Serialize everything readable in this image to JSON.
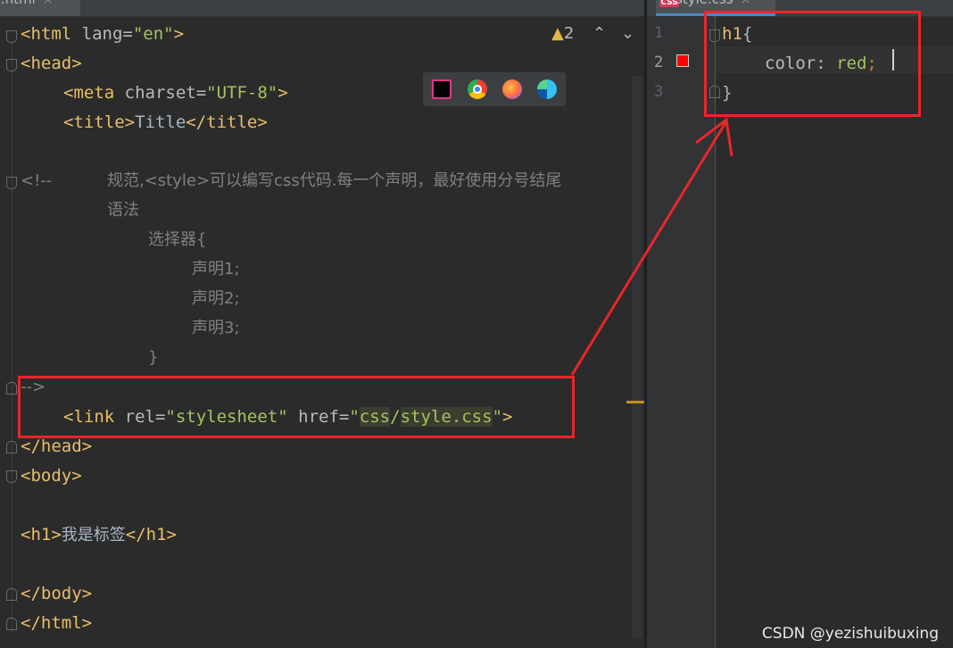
{
  "tabs": {
    "left_label": "x.html",
    "right_label": "style.css",
    "right_badge": "CSS",
    "close_glyph": "×"
  },
  "toolbar": {
    "warning_count": "2",
    "warning_icon": "warning-triangle-icon",
    "up_glyph": "⌃",
    "down_glyph": "⌄"
  },
  "browsers": [
    "intellij-icon",
    "chrome-icon",
    "firefox-icon",
    "edge-icon"
  ],
  "html_editor": {
    "line1_tag": "<html",
    "line1_attr": " lang=",
    "line1_val": "\"en\"",
    "line1_close": ">",
    "line2": "<head>",
    "line3_tag": "<meta",
    "line3_attr": " charset=",
    "line3_val": "\"UTF-8\"",
    "line3_close": ">",
    "line4_open": "<title>",
    "line4_text": "Title",
    "line4_close": "</title>",
    "line6_open": "<!--",
    "line6_text": "规范,<style>可以编写css代码.每一个声明，最好使用分号结尾",
    "line7_text": "语法",
    "line8_text": "选择器{",
    "line9_text": "声明1;",
    "line10_text": "声明2;",
    "line11_text": "声明3;",
    "line12_text": "}",
    "line13_text": "-->",
    "line14_tag": "<link",
    "line14_attr1": " rel=",
    "line14_val1": "\"stylesheet\"",
    "line14_attr2": " href=",
    "line14_q1": "\"",
    "line14_hl1": "css",
    "line14_slash": "/",
    "line14_hl2": "style.css",
    "line14_q2": "\"",
    "line14_close": ">",
    "line15": "</head>",
    "line16": "<body>",
    "line18_open": "<h1>",
    "line18_text": "我是标签",
    "line18_close": "</h1>",
    "line20": "</body>",
    "line21": "</html>"
  },
  "css_editor": {
    "line_numbers": [
      "1",
      "2",
      "3"
    ],
    "selector": "h1",
    "brace_open": "{",
    "property": "color",
    "colon": ": ",
    "value": "red",
    "semicolon": ";",
    "brace_close": "}",
    "swatch_color": "#ff0000"
  },
  "annotation": {
    "box_color": "#e8262a"
  },
  "watermark": "CSDN @yezishuibuxing"
}
